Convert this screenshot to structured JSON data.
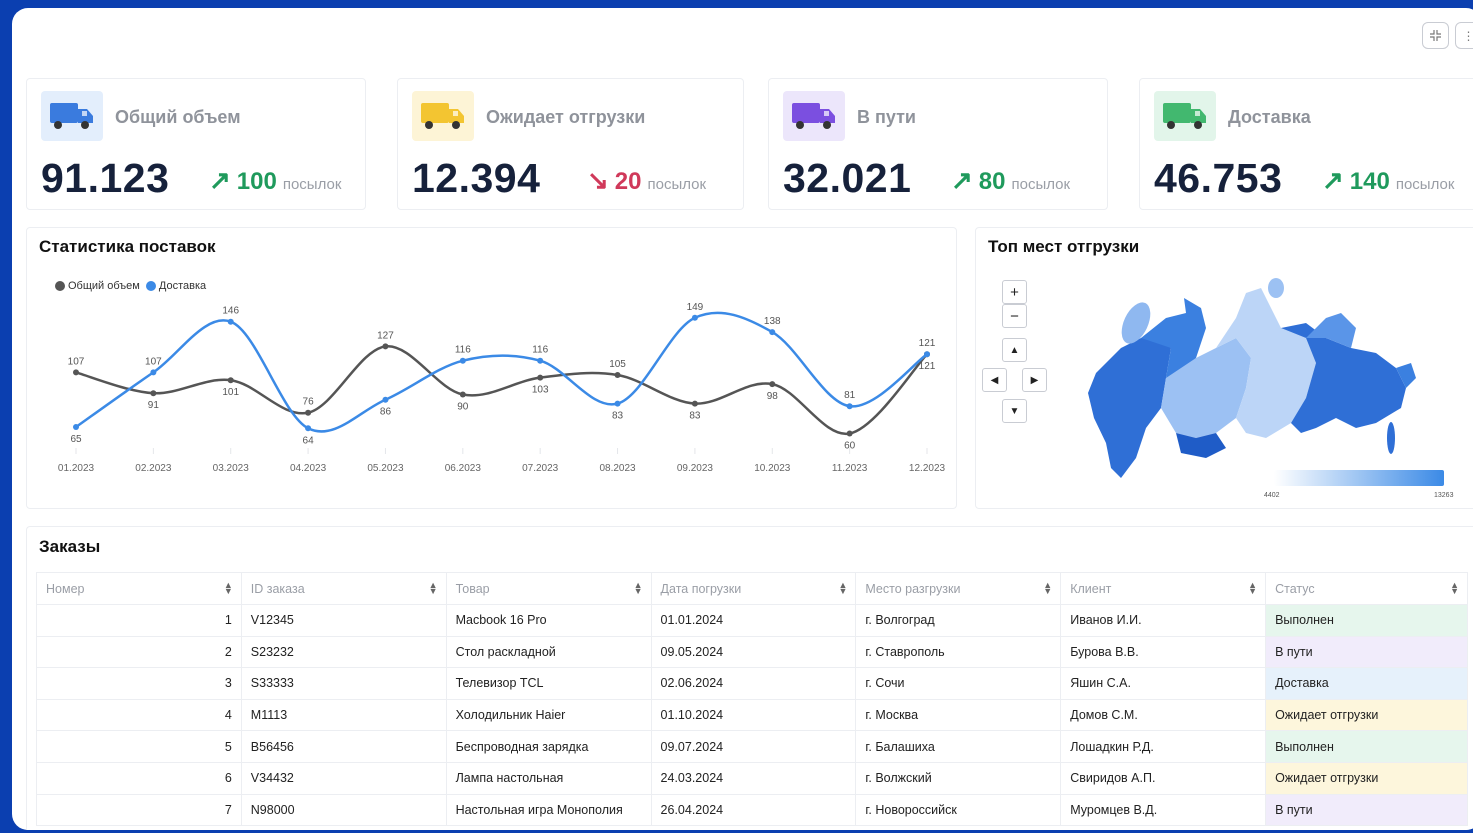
{
  "colors": {
    "background": "#0b3fb0",
    "accent_blue": "#3b8ae6",
    "gray_series": "#555555",
    "up": "#1f9a5c",
    "down": "#d0395a"
  },
  "cards": [
    {
      "label": "Общий объем",
      "value": "91.123",
      "arrow": "↗",
      "delta": "100",
      "unit": "посылок",
      "trend": "up",
      "icon": "truck-icon",
      "icon_bg": "#e3eefc",
      "icon_color": "#3a7bde"
    },
    {
      "label": "Ожидает отгрузки",
      "value": "12.394",
      "arrow": "↘",
      "delta": "20",
      "unit": "посылок",
      "trend": "down",
      "icon": "truck-icon",
      "icon_bg": "#fdf4d6",
      "icon_color": "#f3c531"
    },
    {
      "label": "В пути",
      "value": "32.021",
      "arrow": "↗",
      "delta": "80",
      "unit": "посылок",
      "trend": "up",
      "icon": "truck-icon",
      "icon_bg": "#ece6fb",
      "icon_color": "#7b4fe0"
    },
    {
      "label": "Доставка",
      "value": "46.753",
      "arrow": "↗",
      "delta": "140",
      "unit": "посылок",
      "trend": "up",
      "icon": "truck-icon",
      "icon_bg": "#e2f5ea",
      "icon_color": "#42b86f"
    }
  ],
  "stats": {
    "title": "Статистика поставок"
  },
  "chart_data": {
    "type": "line",
    "categories": [
      "01.2023",
      "02.2023",
      "03.2023",
      "04.2023",
      "05.2023",
      "06.2023",
      "07.2023",
      "08.2023",
      "09.2023",
      "10.2023",
      "11.2023",
      "12.2023"
    ],
    "series": [
      {
        "name": "Общий объем",
        "color": "#555555",
        "values": [
          107,
          91,
          101,
          76,
          127,
          90,
          103,
          105,
          83,
          98,
          60,
          121
        ]
      },
      {
        "name": "Доставка",
        "color": "#3b8ae6",
        "values": [
          65,
          107,
          146,
          64,
          86,
          116,
          116,
          83,
          149,
          138,
          81,
          121
        ]
      }
    ],
    "legend_position": "top-left",
    "grid": false
  },
  "map": {
    "title": "Топ мест отгрузки",
    "controls": {
      "zoom_in": "+",
      "zoom_out": "−",
      "up": "▲",
      "left": "◀",
      "right": "▶",
      "down": "▼"
    },
    "scale_min": "4402",
    "scale_max": "13263"
  },
  "orders": {
    "title": "Заказы",
    "columns": [
      "Номер",
      "ID заказа",
      "Товар",
      "Дата погрузки",
      "Место разгрузки",
      "Клиент",
      "Статус"
    ],
    "rows": [
      {
        "num": "1",
        "id": "V12345",
        "product": "Macbook 16 Pro",
        "date": "01.01.2024",
        "place": "г. Волгоград",
        "client": "Иванов И.И.",
        "status": "Выполнен",
        "status_class": "st-done"
      },
      {
        "num": "2",
        "id": "S23232",
        "product": "Стол раскладной",
        "date": "09.05.2024",
        "place": "г. Ставрополь",
        "client": "Бурова В.В.",
        "status": "В пути",
        "status_class": "st-transit"
      },
      {
        "num": "3",
        "id": "S33333",
        "product": "Телевизор TCL",
        "date": "02.06.2024",
        "place": "г. Сочи",
        "client": "Яшин С.А.",
        "status": "Доставка",
        "status_class": "st-delivery"
      },
      {
        "num": "4",
        "id": "M1113",
        "product": "Холодильник Haier",
        "date": "01.10.2024",
        "place": "г. Москва",
        "client": "Домов С.М.",
        "status": "Ожидает отгрузки",
        "status_class": "st-wait"
      },
      {
        "num": "5",
        "id": "B56456",
        "product": "Беспроводная зарядка",
        "date": "09.07.2024",
        "place": "г. Балашиха",
        "client": "Лошадкин Р.Д.",
        "status": "Выполнен",
        "status_class": "st-done"
      },
      {
        "num": "6",
        "id": "V34432",
        "product": "Лампа настольная",
        "date": "24.03.2024",
        "place": "г. Волжский",
        "client": "Свиридов А.П.",
        "status": "Ожидает отгрузки",
        "status_class": "st-wait"
      },
      {
        "num": "7",
        "id": "N98000",
        "product": "Настольная игра Монополия",
        "date": "26.04.2024",
        "place": "г. Новороссийск",
        "client": "Муромцев В.Д.",
        "status": "В пути",
        "status_class": "st-transit"
      }
    ]
  }
}
